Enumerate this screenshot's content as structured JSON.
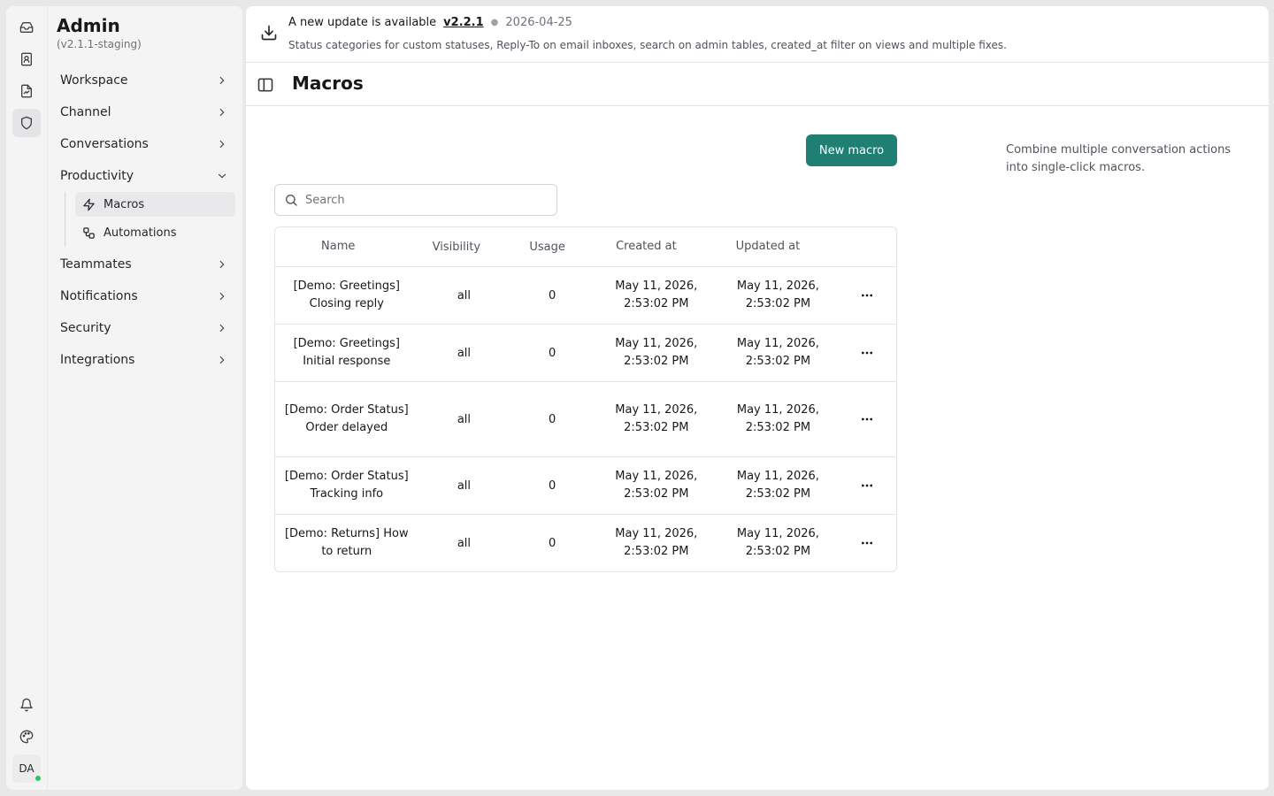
{
  "rail": {
    "icons": [
      "inbox-icon",
      "contacts-icon",
      "reports-icon",
      "admin-shield-icon",
      "bell-icon",
      "palette-icon"
    ],
    "avatar_initials": "DA"
  },
  "admin": {
    "title": "Admin",
    "version": "(v2.1.1-staging)",
    "nav": [
      {
        "label": "Workspace"
      },
      {
        "label": "Channel"
      },
      {
        "label": "Conversations"
      },
      {
        "label": "Productivity"
      },
      {
        "label": "Teammates"
      },
      {
        "label": "Notifications"
      },
      {
        "label": "Security"
      },
      {
        "label": "Integrations"
      }
    ],
    "subnav": [
      {
        "label": "Macros",
        "icon": "zap-icon"
      },
      {
        "label": "Automations",
        "icon": "workflow-icon"
      }
    ]
  },
  "banner": {
    "message": "A new update is available",
    "version": "v2.2.1",
    "date": "2026-04-25",
    "details": "Status categories for custom statuses, Reply-To on email inboxes, search on admin tables, created_at filter on views and multiple fixes."
  },
  "page": {
    "title": "Macros",
    "new_button": "New macro",
    "search_placeholder": "Search",
    "help_text": "Combine multiple conversation actions into single-click macros."
  },
  "table": {
    "columns": [
      "Name",
      "Visibility",
      "Usage",
      "Created at",
      "Updated at"
    ],
    "rows": [
      {
        "name": "[Demo: Greetings] Closing reply",
        "visibility": "all",
        "usage": "0",
        "created": "May 11, 2026, 2:53:02 PM",
        "updated": "May 11, 2026, 2:53:02 PM"
      },
      {
        "name": "[Demo: Greetings] Initial response",
        "visibility": "all",
        "usage": "0",
        "created": "May 11, 2026, 2:53:02 PM",
        "updated": "May 11, 2026, 2:53:02 PM"
      },
      {
        "name": "[Demo: Order Status] Order delayed",
        "visibility": "all",
        "usage": "0",
        "created": "May 11, 2026, 2:53:02 PM",
        "updated": "May 11, 2026, 2:53:02 PM"
      },
      {
        "name": "[Demo: Order Status] Tracking info",
        "visibility": "all",
        "usage": "0",
        "created": "May 11, 2026, 2:53:02 PM",
        "updated": "May 11, 2026, 2:53:02 PM"
      },
      {
        "name": "[Demo: Returns] How to return",
        "visibility": "all",
        "usage": "0",
        "created": "May 11, 2026, 2:53:02 PM",
        "updated": "May 11, 2026, 2:53:02 PM"
      }
    ]
  }
}
